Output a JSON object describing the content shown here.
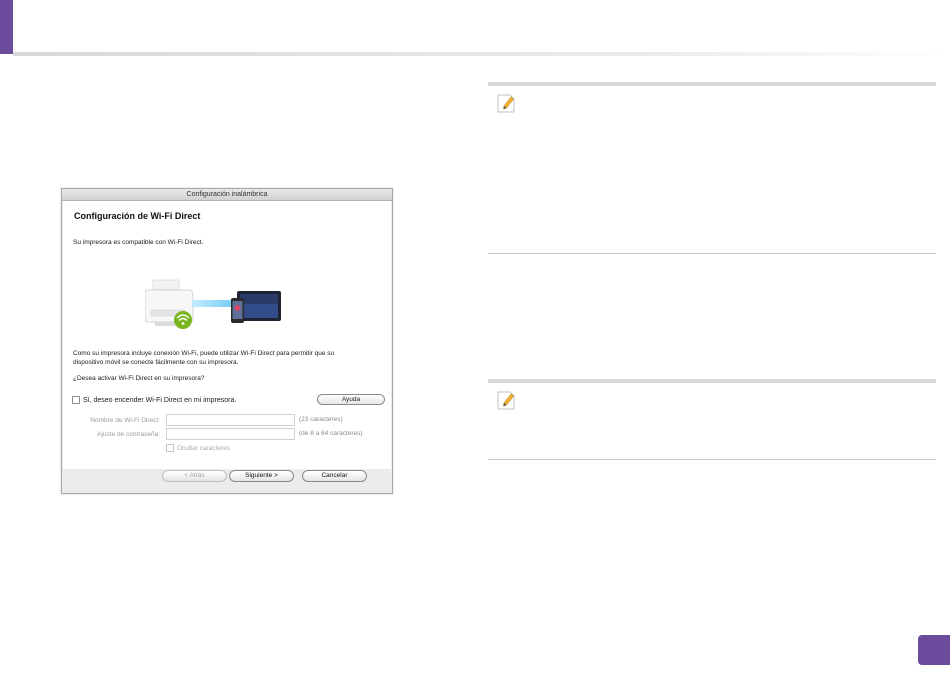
{
  "dialog": {
    "title": "Configuración inalámbrica",
    "heading": "Configuración de Wi-Fi Direct",
    "compat_text": "Su impresora es compatible con Wi-Fi Direct.",
    "description_line1": "Como su impresora incluye conexión Wi-Fi, puede utilizar Wi-Fi Direct para permitir que su",
    "description_line2": "dispositivo móvil se conecte fácilmente con su impresora.",
    "question": "¿Desea activar Wi-Fi Direct en su impresora?",
    "enable_checkbox_label": "Sí, deseo encender Wi-Fi Direct en mi impresora.",
    "help_button": "Ayuda",
    "name_label": "Nombre de Wi-Fi Direct:",
    "name_hint": "(23 caracteres)",
    "password_label": "Ajuste de contraseña:",
    "password_hint": "(de 8 a 64 caracteres)",
    "hide_chars_label": "Ocultar caracteres",
    "back_button": "< Atrás",
    "next_button": "Siguiente >",
    "cancel_button": "Cancelar"
  },
  "colors": {
    "accent": "#6a4b9c",
    "wifi": "#7ab51d"
  },
  "icons": [
    "note-pencil-icon",
    "printer-icon",
    "wifi-icon",
    "tablet-icon"
  ]
}
